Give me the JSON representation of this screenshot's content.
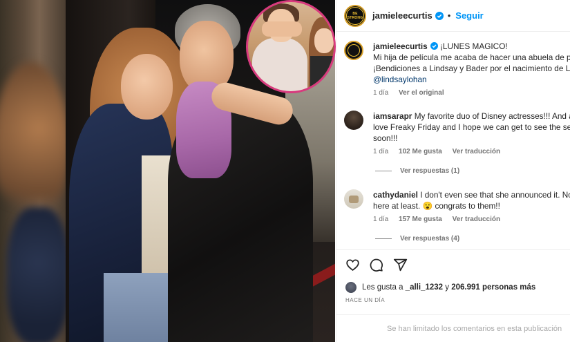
{
  "post": {
    "username": "jamieleecurtis",
    "follow_label": "Seguir",
    "avatar_text": "BE\nSTRONG"
  },
  "caption": {
    "username": "jamieleecurtis",
    "line1": "¡LUNES MAGICO!",
    "line2": "Mi hija de película me acaba de hacer una abuela de pe",
    "line3": "¡Bendiciones a Lindsay y Bader por el nacimiento de Lua",
    "mention": "@lindsaylohan",
    "time": "1 día",
    "see_original": "Ver el original"
  },
  "comments": [
    {
      "username": "iamsarapr",
      "line1": "My favorite duo of Disney actresses!!! And al",
      "line2": "love Freaky Friday and I hope we can get to see the seq",
      "line3": "soon!!!",
      "time": "1 día",
      "likes": "102 Me gusta",
      "translate": "Ver traducción",
      "replies": "Ver respuestas (1)"
    },
    {
      "username": "cathydaniel",
      "line1": "I don't even see that she announced it. Not",
      "line2": "here at least. 😮 congrats to them!!",
      "time": "1 día",
      "likes": "157 Me gusta",
      "translate": "Ver traducción",
      "replies": "Ver respuestas (4)"
    }
  ],
  "actions": {
    "icons": [
      "heart-icon",
      "comment-icon",
      "share-icon"
    ]
  },
  "likes": {
    "prefix": "Les gusta a",
    "user": "_alli_1232",
    "connector": "y",
    "count": "206.991 personas más"
  },
  "timestamp": "HACE UN DÍA",
  "footer": {
    "text": "Se han limitado los comentarios en esta publicación"
  },
  "colors": {
    "accent_blue": "#0095f6",
    "verified": "#0095f6",
    "inset_border": "#d83a7e",
    "avatar_ring": "#d8a12a"
  }
}
